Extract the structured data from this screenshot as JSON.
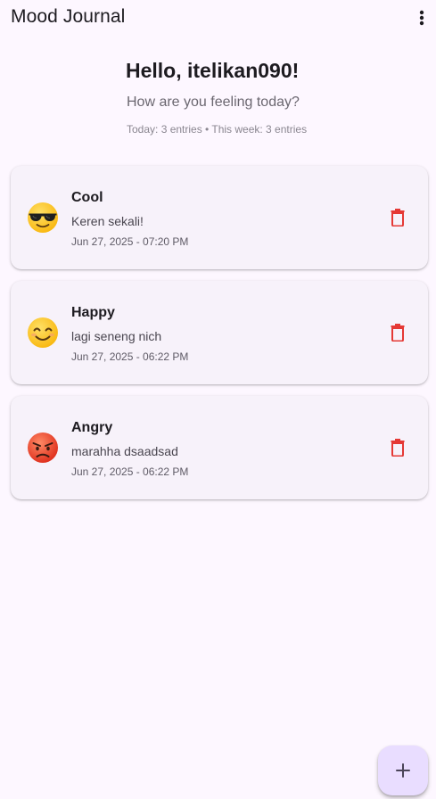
{
  "appbar": {
    "title": "Mood Journal",
    "menu_icon": "more-vert-icon"
  },
  "header": {
    "greeting": "Hello, itelikan090!",
    "subtitle": "How are you feeling today?",
    "stats": "Today: 3 entries • This week: 3 entries"
  },
  "entries": [
    {
      "mood": "Cool",
      "emoji_icon": "sunglasses-face-icon",
      "note": "Keren sekali!",
      "date": "Jun 27, 2025 - 07:20 PM"
    },
    {
      "mood": "Happy",
      "emoji_icon": "smiling-face-icon",
      "note": "lagi seneng nich",
      "date": "Jun 27, 2025 - 06:22 PM"
    },
    {
      "mood": "Angry",
      "emoji_icon": "angry-face-icon",
      "note": "marahha dsaadsad",
      "date": "Jun 27, 2025 - 06:22 PM"
    }
  ],
  "fab": {
    "icon": "plus-icon"
  },
  "colors": {
    "background": "#fdf7ff",
    "card": "#f7f2fa",
    "delete": "#e53935",
    "fab": "#e9ddff",
    "fab_icon": "#4a4458"
  }
}
